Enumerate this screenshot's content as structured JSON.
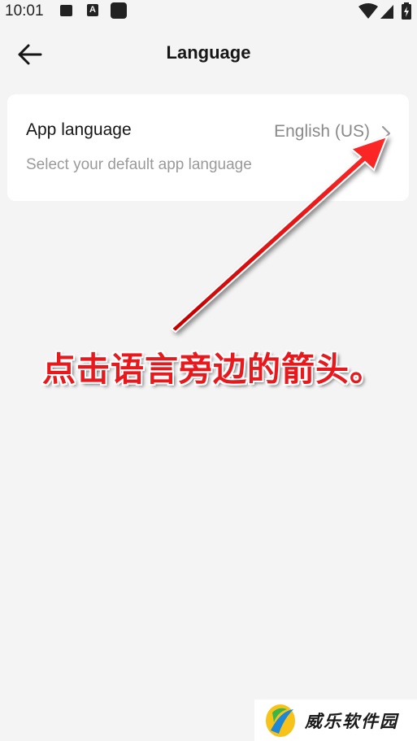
{
  "status_bar": {
    "time": "10:01",
    "icons": [
      "image-icon",
      "text-a-icon",
      "square-icon",
      "wifi-icon",
      "signal-icon",
      "battery-charging-icon"
    ],
    "a_glyph": "A"
  },
  "header": {
    "back_icon": "arrow-left-icon",
    "title": "Language"
  },
  "settings": {
    "app_language": {
      "label": "App language",
      "value": "English (US)",
      "description": "Select your default app language",
      "chevron_icon": "chevron-right-icon"
    }
  },
  "annotation": {
    "text": "点击语言旁边的箭头。",
    "color": "#e8191d"
  },
  "watermark": {
    "text": "威乐软件园"
  },
  "colors": {
    "background": "#f4f4f4",
    "card": "#ffffff",
    "primary_text": "#161616",
    "secondary_text": "#8a8a8a"
  }
}
